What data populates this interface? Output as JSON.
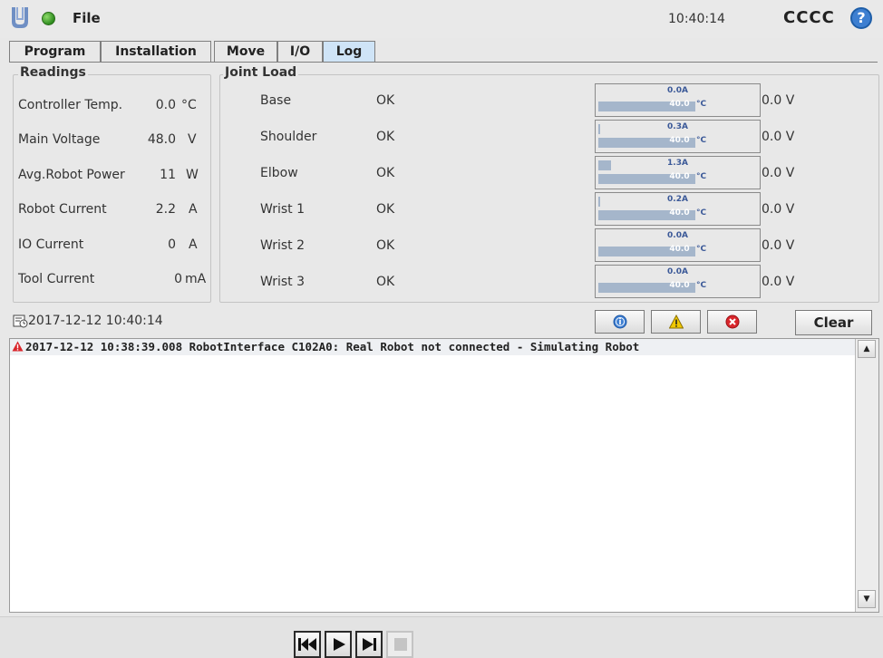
{
  "header": {
    "file_label": "File",
    "clock": "10:40:14",
    "robot_name": "CCCC",
    "help_glyph": "?"
  },
  "tabs": [
    {
      "label": "Program",
      "active": false
    },
    {
      "label": "Installation",
      "active": false
    },
    {
      "label": "Move",
      "active": false
    },
    {
      "label": "I/O",
      "active": false
    },
    {
      "label": "Log",
      "active": true
    }
  ],
  "readings": {
    "title": "Readings",
    "items": [
      {
        "label": "Controller Temp.",
        "value": "0.0",
        "unit": "°C"
      },
      {
        "label": "Main Voltage",
        "value": "48.0",
        "unit": "V"
      },
      {
        "label": "Avg.Robot Power",
        "value": "11",
        "unit": "W"
      },
      {
        "label": "Robot Current",
        "value": "2.2",
        "unit": "A"
      },
      {
        "label": "IO Current",
        "value": "0",
        "unit": "A"
      },
      {
        "label": "Tool Current",
        "value": "0",
        "unit": "mA"
      }
    ]
  },
  "joint_load": {
    "title": "Joint Load",
    "joints": [
      {
        "name": "Base",
        "status": "OK",
        "current": "0.0A",
        "current_level": 0.0,
        "temp": "40.0",
        "temp_unit": "°C",
        "voltage": "0.0 V"
      },
      {
        "name": "Shoulder",
        "status": "OK",
        "current": "0.3A",
        "current_level": 0.01,
        "temp": "40.0",
        "temp_unit": "°C",
        "voltage": "0.0 V"
      },
      {
        "name": "Elbow",
        "status": "OK",
        "current": "1.3A",
        "current_level": 0.08,
        "temp": "40.0",
        "temp_unit": "°C",
        "voltage": "0.0 V"
      },
      {
        "name": "Wrist 1",
        "status": "OK",
        "current": "0.2A",
        "current_level": 0.01,
        "temp": "40.0",
        "temp_unit": "°C",
        "voltage": "0.0 V"
      },
      {
        "name": "Wrist 2",
        "status": "OK",
        "current": "0.0A",
        "current_level": 0.0,
        "temp": "40.0",
        "temp_unit": "°C",
        "voltage": "0.0 V"
      },
      {
        "name": "Wrist 3",
        "status": "OK",
        "current": "0.0A",
        "current_level": 0.0,
        "temp": "40.0",
        "temp_unit": "°C",
        "voltage": "0.0 V"
      }
    ]
  },
  "log": {
    "timestamp": "2017-12-12 10:40:14",
    "clear_label": "Clear",
    "filters": [
      {
        "name": "info-filter",
        "icon": "info-icon",
        "color": "#3f7fd2"
      },
      {
        "name": "warning-filter",
        "icon": "warning-icon",
        "color": "#f0c800"
      },
      {
        "name": "error-filter",
        "icon": "error-icon",
        "color": "#d9262c"
      }
    ],
    "entries": [
      {
        "level": "warning",
        "text": "2017-12-12 10:38:39.008 RobotInterface C102A0: Real Robot not connected - Simulating Robot"
      }
    ]
  },
  "colors": {
    "active_tab": "#cfe4f7",
    "bar_fill": "#a5b6cb",
    "status_green": "#2e8b1f",
    "help_blue": "#3d7fd1"
  }
}
